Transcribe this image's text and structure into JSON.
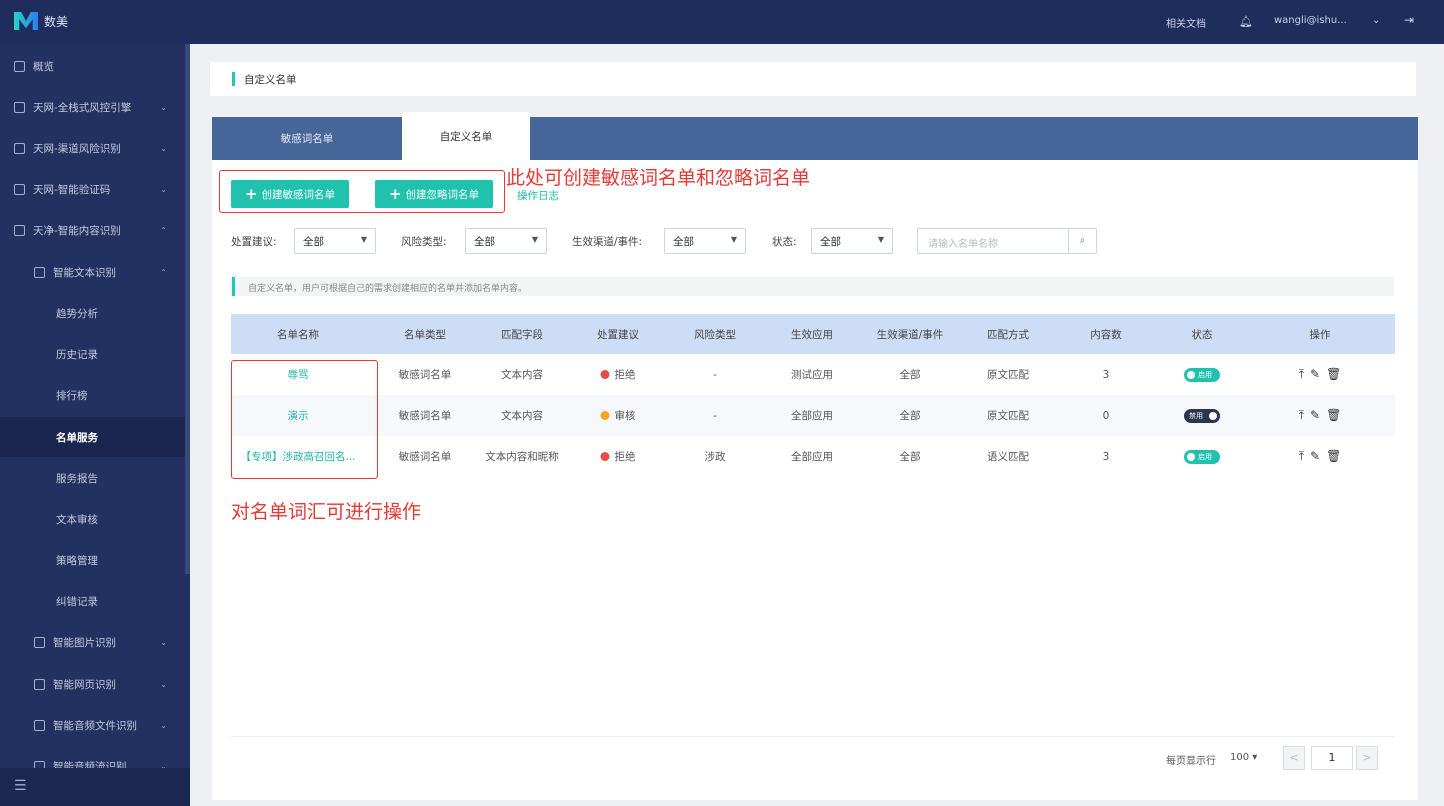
{
  "app": {
    "logo_text": "数美"
  },
  "topbar": {
    "docs": "相关文档",
    "user": "wangli@ishu...",
    "user_chevron": "⌄",
    "logout": "⇥"
  },
  "sidebar": {
    "items": [
      {
        "label": "概览"
      },
      {
        "label": "天网-全栈式风控引擎"
      },
      {
        "label": "天网-渠道风险识别"
      },
      {
        "label": "天网-智能验证码"
      },
      {
        "label": "天净-智能内容识别"
      },
      {
        "label": "智能文本识别"
      },
      {
        "label": "趋势分析"
      },
      {
        "label": "历史记录"
      },
      {
        "label": "排行榜"
      },
      {
        "label": "名单服务"
      },
      {
        "label": "服务报告"
      },
      {
        "label": "文本审核"
      },
      {
        "label": "策略管理"
      },
      {
        "label": "纠错记录"
      },
      {
        "label": "智能图片识别"
      },
      {
        "label": "智能网页识别"
      },
      {
        "label": "智能音频文件识别"
      },
      {
        "label": "智能音频流识别"
      }
    ]
  },
  "breadcrumb": "自定义名单",
  "tabs": [
    "敏感词名单",
    "自定义名单"
  ],
  "actions": {
    "create_sensitive": "创建敏感词名单",
    "create_ignore": "创建忽略词名单",
    "log": "操作日志"
  },
  "annotations": {
    "create": "此处可创建敏感词名单和忽略词名单",
    "ops": "对名单词汇可进行操作"
  },
  "filters": {
    "disposal_label": "处置建议:",
    "disposal": "全部",
    "risk_label": "风险类型:",
    "risk": "全部",
    "channel_label": "生效渠道/事件:",
    "channel": "全部",
    "status_label": "状态:",
    "status": "全部",
    "search_placeholder": "请输入名单名称"
  },
  "tip": "自定义名单，用户可根据自己的需求创建相应的名单并添加名单内容。",
  "table": {
    "headers": [
      "名单名称",
      "名单类型",
      "匹配字段",
      "处置建议",
      "风险类型",
      "生效应用",
      "生效渠道/事件",
      "匹配方式",
      "内容数",
      "状态",
      "操作"
    ],
    "rows": [
      {
        "name": "辱骂",
        "type": "敏感词名单",
        "field": "文本内容",
        "advice": "拒绝",
        "advice_color": "#e84b4b",
        "risk": "-",
        "app": "测试应用",
        "channel": "全部",
        "match": "原文匹配",
        "count": "3",
        "status": "启用",
        "on": true
      },
      {
        "name": "演示",
        "type": "敏感词名单",
        "field": "文本内容",
        "advice": "审核",
        "advice_color": "#f5a623",
        "risk": "-",
        "app": "全部应用",
        "channel": "全部",
        "match": "原文匹配",
        "count": "0",
        "status": "禁用",
        "on": false
      },
      {
        "name": "【专项】涉政高召回名...",
        "type": "敏感词名单",
        "field": "文本内容和昵称",
        "advice": "拒绝",
        "advice_color": "#e84b4b",
        "risk": "涉政",
        "app": "全部应用",
        "channel": "全部",
        "match": "语义匹配",
        "count": "3",
        "status": "启用",
        "on": true
      }
    ]
  },
  "pagination": {
    "page_size_label": "每页显示行",
    "page_size": "100",
    "page": "1",
    "prev": "<",
    "next": ">"
  },
  "colors": {
    "accent": "#20c2ae",
    "sidebar": "#22315f",
    "header_row": "#cdddf6"
  }
}
